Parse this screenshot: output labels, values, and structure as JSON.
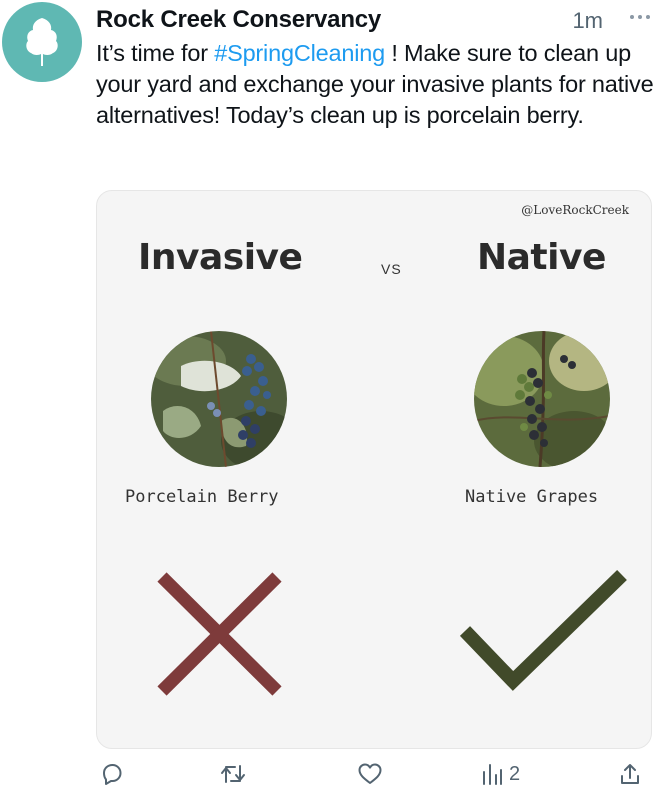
{
  "tweet": {
    "author": "Rock Creek Conservancy",
    "time": "1m",
    "text_before": "It’s time for ",
    "hashtag": "#SpringCleaning",
    "text_after": " ! Make sure to clean up your yard and exchange your invasive plants for native alternatives! Today’s clean up is porcelain berry."
  },
  "card": {
    "handle": "@LoveRockCreek",
    "left_heading": "Invasive",
    "vs": "VS",
    "right_heading": "Native",
    "left_caption": "Porcelain Berry",
    "right_caption": "Native Grapes",
    "left_mark": "cross-icon",
    "right_mark": "check-icon"
  },
  "actions": {
    "reply": "",
    "repost": "",
    "like": "",
    "views": "2",
    "share": ""
  },
  "colors": {
    "brand_teal": "#5fb8b3",
    "hashtag_blue": "#1d9bf0",
    "cross_red": "#7e3b3b",
    "check_green": "#414a2a",
    "icon_gray": "#536471"
  }
}
